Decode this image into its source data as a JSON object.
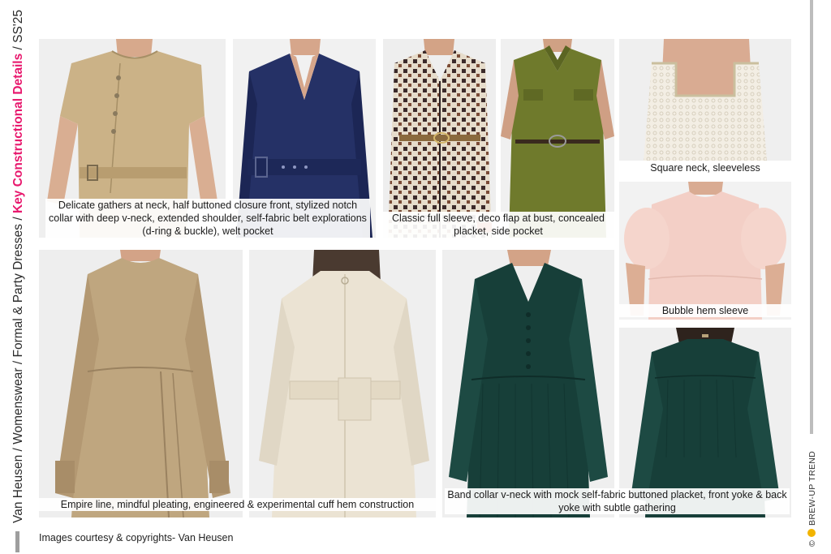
{
  "header": {
    "vertical_title": "Van Heusen / Womenswear / Formal & Party Dresses / ",
    "vertical_title_highlight": "Key Constructional Details",
    "vertical_title_suffix": " / SS'25"
  },
  "captions": {
    "gathers": "Delicate gathers at neck, half buttoned closure front, stylized notch collar with deep v-neck, extended shoulder, self-fabric belt explorations (d-ring & buckle), welt pocket",
    "sleeve": "Classic full sleeve, deco flap at bust, concealed placket, side pocket",
    "square": "Square neck, sleeveless",
    "bubble": "Bubble hem sleeve",
    "empire": "Empire line, mindful pleating, engineered & experimental cuff hem construction",
    "band": "Band collar v-neck with mock self-fabric buttoned placket, front yoke & back yoke with subtle gathering"
  },
  "footer": {
    "credit": "Images courtesy & copyrights- Van Heusen",
    "brand_copyright": "©",
    "brand_name": "BREW-UP TREND"
  },
  "colors": {
    "highlight": "#e8186d",
    "beige": "#cbb287",
    "navy": "#253166",
    "olive": "#6f7a2c",
    "teal": "#173f39",
    "cream": "#ebe3d3",
    "blush": "#f3cfc6",
    "khaki": "#bfa67f"
  }
}
